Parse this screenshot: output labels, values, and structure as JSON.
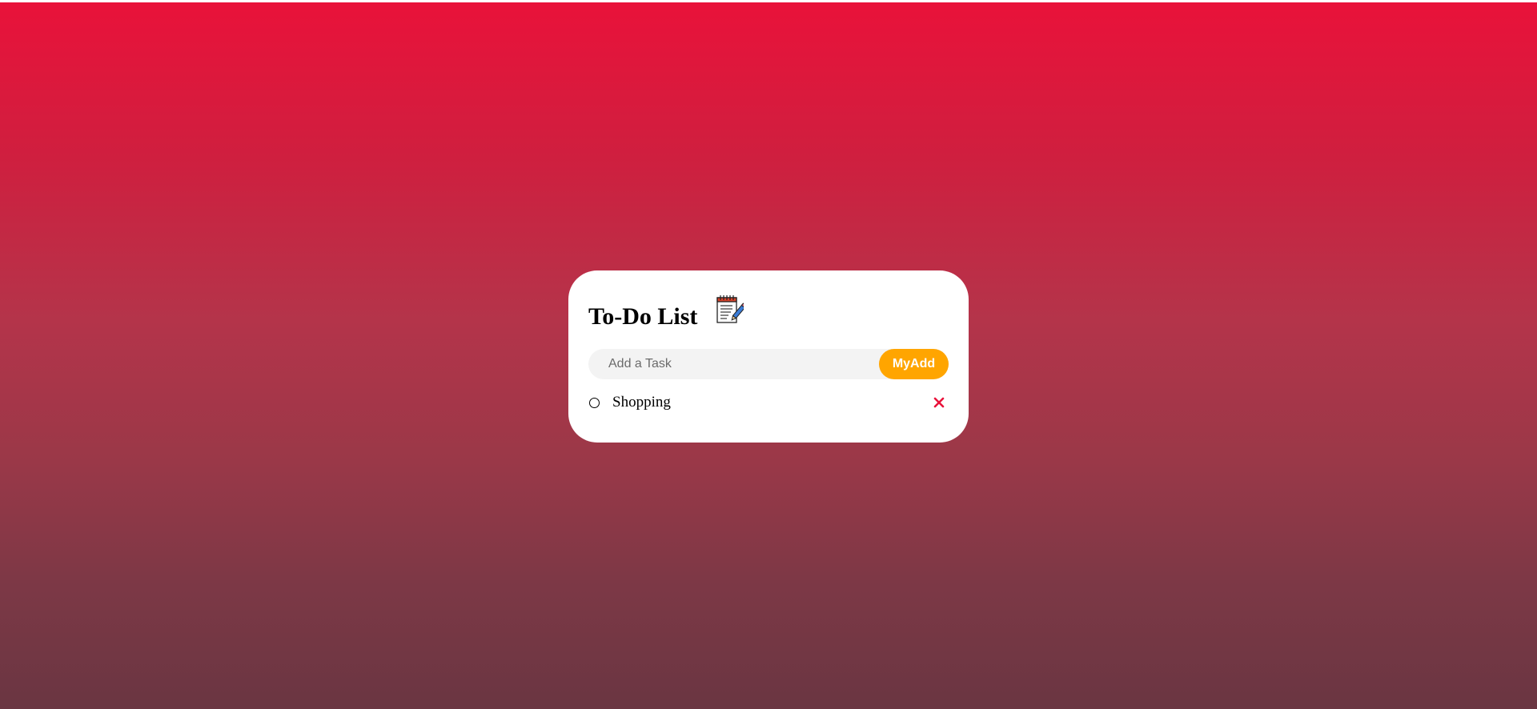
{
  "background": {
    "gradient_top": "#e9123a",
    "gradient_bottom": "#6a3642"
  },
  "card": {
    "title": "To-Do List",
    "title_icon": "notepad-pencil-icon"
  },
  "task_form": {
    "placeholder": "Add a Task",
    "value": "",
    "add_button_label": "MyAdd",
    "add_button_color": "#ffa500"
  },
  "tasks": [
    {
      "label": "Shopping",
      "checked": false,
      "check_icon": "circle-icon",
      "delete_icon": "close-icon",
      "delete_color": "#e9123a"
    }
  ]
}
